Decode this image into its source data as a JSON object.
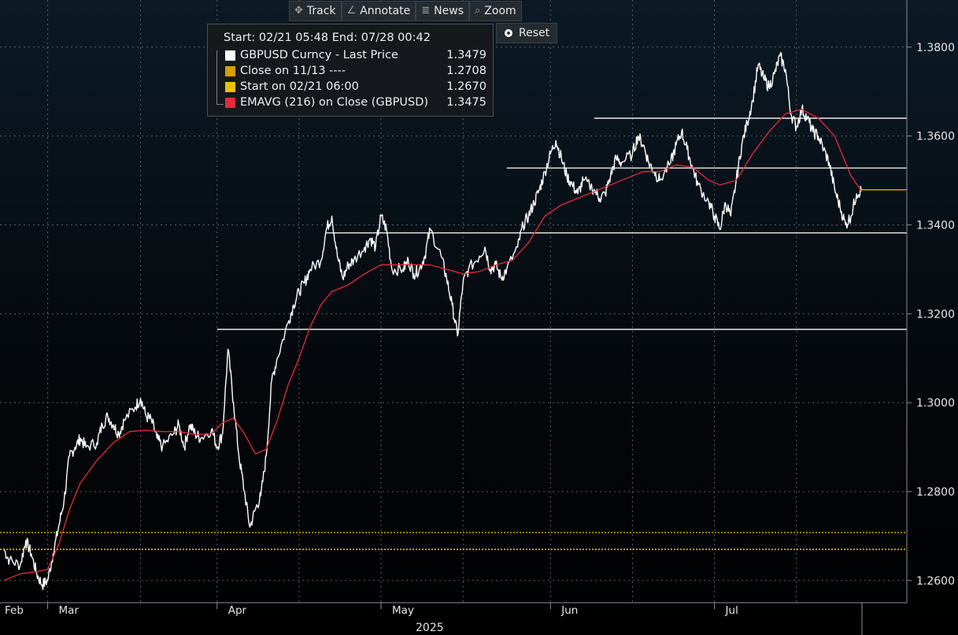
{
  "toolbar": {
    "track": "Track",
    "annotate": "Annotate",
    "news": "News",
    "zoom": "Zoom",
    "reset": "Reset"
  },
  "legend": {
    "header": "Start: 02/21 05:48 End: 07/28 00:42",
    "rows": [
      {
        "name": "GBPUSD Curncy - Last Price",
        "value": "1.3479",
        "color": "#ffffff"
      },
      {
        "name": "Close on 11/13 ----",
        "value": "1.2708",
        "color": "#d6a000"
      },
      {
        "name": "Start on 02/21 06:00",
        "value": "1.2670",
        "color": "#e8c000"
      },
      {
        "name": "EMAVG (216)  on Close (GBPUSD)",
        "value": "1.3475",
        "color": "#e8283c"
      }
    ]
  },
  "chart_data": {
    "type": "line",
    "ylim": [
      1.255,
      1.3906
    ],
    "y_ticks": [
      1.26,
      1.28,
      1.3,
      1.32,
      1.34,
      1.36,
      1.38
    ],
    "y_tick_labels": [
      "1.2600",
      "1.2800",
      "1.3000",
      "1.3200",
      "1.3400",
      "1.3600",
      "1.3800"
    ],
    "x_start": "2025-02-21",
    "x_end": "2025-07-28",
    "x_ticks": [
      {
        "label": "Feb",
        "date": "2025-02-21"
      },
      {
        "label": "Mar",
        "date": "2025-03-01"
      },
      {
        "label": "Apr",
        "date": "2025-04-01"
      },
      {
        "label": "May",
        "date": "2025-05-01"
      },
      {
        "label": "Jun",
        "date": "2025-06-01"
      },
      {
        "label": "Jul",
        "date": "2025-07-01"
      }
    ],
    "x_axis_year": "2025",
    "grid": true,
    "series": [
      {
        "name": "GBPUSD Curncy - Last Price",
        "color": "#ffffff",
        "points": [
          [
            "2025-02-21",
            1.267
          ],
          [
            "2025-02-22",
            1.2645
          ],
          [
            "2025-02-24",
            1.2635
          ],
          [
            "2025-02-25",
            1.269
          ],
          [
            "2025-02-26",
            1.266
          ],
          [
            "2025-02-27",
            1.2615
          ],
          [
            "2025-02-28",
            1.259
          ],
          [
            "2025-03-01",
            1.26
          ],
          [
            "2025-03-02",
            1.266
          ],
          [
            "2025-03-03",
            1.272
          ],
          [
            "2025-03-04",
            1.278
          ],
          [
            "2025-03-05",
            1.288
          ],
          [
            "2025-03-06",
            1.29
          ],
          [
            "2025-03-07",
            1.292
          ],
          [
            "2025-03-08",
            1.29
          ],
          [
            "2025-03-10",
            1.291
          ],
          [
            "2025-03-11",
            1.295
          ],
          [
            "2025-03-12",
            1.297
          ],
          [
            "2025-03-13",
            1.295
          ],
          [
            "2025-03-14",
            1.293
          ],
          [
            "2025-03-15",
            1.296
          ],
          [
            "2025-03-17",
            1.299
          ],
          [
            "2025-03-18",
            1.301
          ],
          [
            "2025-03-19",
            1.297
          ],
          [
            "2025-03-20",
            1.296
          ],
          [
            "2025-03-21",
            1.292
          ],
          [
            "2025-03-22",
            1.29
          ],
          [
            "2025-03-24",
            1.293
          ],
          [
            "2025-03-25",
            1.295
          ],
          [
            "2025-03-26",
            1.29
          ],
          [
            "2025-03-27",
            1.295
          ],
          [
            "2025-03-28",
            1.293
          ],
          [
            "2025-03-29",
            1.292
          ],
          [
            "2025-03-31",
            1.294
          ],
          [
            "2025-04-01",
            1.29
          ],
          [
            "2025-04-02",
            1.293
          ],
          [
            "2025-04-03",
            1.312
          ],
          [
            "2025-04-04",
            1.3
          ],
          [
            "2025-04-05",
            1.288
          ],
          [
            "2025-04-06",
            1.28
          ],
          [
            "2025-04-07",
            1.272
          ],
          [
            "2025-04-08",
            1.276
          ],
          [
            "2025-04-09",
            1.279
          ],
          [
            "2025-04-10",
            1.288
          ],
          [
            "2025-04-11",
            1.305
          ],
          [
            "2025-04-12",
            1.31
          ],
          [
            "2025-04-14",
            1.318
          ],
          [
            "2025-04-15",
            1.322
          ],
          [
            "2025-04-16",
            1.325
          ],
          [
            "2025-04-17",
            1.327
          ],
          [
            "2025-04-18",
            1.33
          ],
          [
            "2025-04-20",
            1.332
          ],
          [
            "2025-04-21",
            1.339
          ],
          [
            "2025-04-22",
            1.342
          ],
          [
            "2025-04-23",
            1.333
          ],
          [
            "2025-04-24",
            1.328
          ],
          [
            "2025-04-25",
            1.331
          ],
          [
            "2025-04-26",
            1.332
          ],
          [
            "2025-04-28",
            1.335
          ],
          [
            "2025-04-29",
            1.337
          ],
          [
            "2025-04-30",
            1.335
          ],
          [
            "2025-05-01",
            1.342
          ],
          [
            "2025-05-02",
            1.339
          ],
          [
            "2025-05-03",
            1.33
          ],
          [
            "2025-05-05",
            1.33
          ],
          [
            "2025-05-06",
            1.332
          ],
          [
            "2025-05-07",
            1.329
          ],
          [
            "2025-05-08",
            1.33
          ],
          [
            "2025-05-09",
            1.333
          ],
          [
            "2025-05-10",
            1.339
          ],
          [
            "2025-05-12",
            1.333
          ],
          [
            "2025-05-13",
            1.328
          ],
          [
            "2025-05-14",
            1.322
          ],
          [
            "2025-05-15",
            1.315
          ],
          [
            "2025-05-16",
            1.327
          ],
          [
            "2025-05-17",
            1.33
          ],
          [
            "2025-05-19",
            1.333
          ],
          [
            "2025-05-20",
            1.335
          ],
          [
            "2025-05-21",
            1.33
          ],
          [
            "2025-05-22",
            1.331
          ],
          [
            "2025-05-23",
            1.328
          ],
          [
            "2025-05-24",
            1.33
          ],
          [
            "2025-05-26",
            1.335
          ],
          [
            "2025-05-27",
            1.34
          ],
          [
            "2025-05-28",
            1.342
          ],
          [
            "2025-05-29",
            1.345
          ],
          [
            "2025-05-30",
            1.348
          ],
          [
            "2025-05-31",
            1.352
          ],
          [
            "2025-06-01",
            1.356
          ],
          [
            "2025-06-02",
            1.359
          ],
          [
            "2025-06-03",
            1.355
          ],
          [
            "2025-06-04",
            1.351
          ],
          [
            "2025-06-05",
            1.349
          ],
          [
            "2025-06-06",
            1.347
          ],
          [
            "2025-06-07",
            1.35
          ],
          [
            "2025-06-09",
            1.348
          ],
          [
            "2025-06-10",
            1.346
          ],
          [
            "2025-06-11",
            1.347
          ],
          [
            "2025-06-12",
            1.351
          ],
          [
            "2025-06-13",
            1.355
          ],
          [
            "2025-06-14",
            1.354
          ],
          [
            "2025-06-16",
            1.356
          ],
          [
            "2025-06-17",
            1.36
          ],
          [
            "2025-06-18",
            1.358
          ],
          [
            "2025-06-19",
            1.354
          ],
          [
            "2025-06-20",
            1.352
          ],
          [
            "2025-06-21",
            1.35
          ],
          [
            "2025-06-23",
            1.354
          ],
          [
            "2025-06-24",
            1.358
          ],
          [
            "2025-06-25",
            1.361
          ],
          [
            "2025-06-26",
            1.357
          ],
          [
            "2025-06-27",
            1.353
          ],
          [
            "2025-06-28",
            1.349
          ],
          [
            "2025-06-30",
            1.345
          ],
          [
            "2025-07-01",
            1.342
          ],
          [
            "2025-07-02",
            1.339
          ],
          [
            "2025-07-03",
            1.345
          ],
          [
            "2025-07-04",
            1.342
          ],
          [
            "2025-07-05",
            1.35
          ],
          [
            "2025-07-06",
            1.358
          ],
          [
            "2025-07-07",
            1.363
          ],
          [
            "2025-07-08",
            1.368
          ],
          [
            "2025-07-09",
            1.376
          ],
          [
            "2025-07-10",
            1.373
          ],
          [
            "2025-07-11",
            1.371
          ],
          [
            "2025-07-12",
            1.374
          ],
          [
            "2025-07-13",
            1.378
          ],
          [
            "2025-07-14",
            1.375
          ],
          [
            "2025-07-15",
            1.365
          ],
          [
            "2025-07-16",
            1.362
          ],
          [
            "2025-07-17",
            1.366
          ],
          [
            "2025-07-18",
            1.364
          ],
          [
            "2025-07-19",
            1.361
          ],
          [
            "2025-07-20",
            1.36
          ],
          [
            "2025-07-21",
            1.357
          ],
          [
            "2025-07-22",
            1.354
          ],
          [
            "2025-07-23",
            1.348
          ],
          [
            "2025-07-24",
            1.344
          ],
          [
            "2025-07-25",
            1.34
          ],
          [
            "2025-07-26",
            1.342
          ],
          [
            "2025-07-27",
            1.347
          ],
          [
            "2025-07-28",
            1.3479
          ]
        ]
      },
      {
        "name": "EMAVG (216)  on Close (GBPUSD)",
        "color": "#e8283c",
        "points": [
          [
            "2025-02-21",
            1.26
          ],
          [
            "2025-02-24",
            1.2615
          ],
          [
            "2025-02-27",
            1.262
          ],
          [
            "2025-03-01",
            1.2625
          ],
          [
            "2025-03-03",
            1.268
          ],
          [
            "2025-03-05",
            1.276
          ],
          [
            "2025-03-07",
            1.282
          ],
          [
            "2025-03-10",
            1.287
          ],
          [
            "2025-03-13",
            1.291
          ],
          [
            "2025-03-16",
            1.2935
          ],
          [
            "2025-03-19",
            1.2938
          ],
          [
            "2025-03-22",
            1.2935
          ],
          [
            "2025-03-25",
            1.2935
          ],
          [
            "2025-03-28",
            1.2928
          ],
          [
            "2025-03-31",
            1.293
          ],
          [
            "2025-04-02",
            1.2955
          ],
          [
            "2025-04-04",
            1.2965
          ],
          [
            "2025-04-06",
            1.293
          ],
          [
            "2025-04-08",
            1.2885
          ],
          [
            "2025-04-10",
            1.2895
          ],
          [
            "2025-04-12",
            1.296
          ],
          [
            "2025-04-14",
            1.304
          ],
          [
            "2025-04-16",
            1.31
          ],
          [
            "2025-04-18",
            1.317
          ],
          [
            "2025-04-20",
            1.322
          ],
          [
            "2025-04-22",
            1.325
          ],
          [
            "2025-04-25",
            1.3265
          ],
          [
            "2025-04-28",
            1.329
          ],
          [
            "2025-05-01",
            1.331
          ],
          [
            "2025-05-04",
            1.331
          ],
          [
            "2025-05-07",
            1.331
          ],
          [
            "2025-05-10",
            1.331
          ],
          [
            "2025-05-13",
            1.33
          ],
          [
            "2025-05-16",
            1.329
          ],
          [
            "2025-05-19",
            1.3295
          ],
          [
            "2025-05-22",
            1.331
          ],
          [
            "2025-05-25",
            1.332
          ],
          [
            "2025-05-28",
            1.336
          ],
          [
            "2025-05-31",
            1.342
          ],
          [
            "2025-06-03",
            1.3445
          ],
          [
            "2025-06-06",
            1.346
          ],
          [
            "2025-06-09",
            1.3475
          ],
          [
            "2025-06-12",
            1.349
          ],
          [
            "2025-06-15",
            1.3505
          ],
          [
            "2025-06-18",
            1.352
          ],
          [
            "2025-06-21",
            1.352
          ],
          [
            "2025-06-24",
            1.3535
          ],
          [
            "2025-06-27",
            1.353
          ],
          [
            "2025-06-30",
            1.35
          ],
          [
            "2025-07-02",
            1.349
          ],
          [
            "2025-07-05",
            1.35
          ],
          [
            "2025-07-08",
            1.356
          ],
          [
            "2025-07-11",
            1.361
          ],
          [
            "2025-07-14",
            1.365
          ],
          [
            "2025-07-17",
            1.366
          ],
          [
            "2025-07-20",
            1.364
          ],
          [
            "2025-07-23",
            1.36
          ],
          [
            "2025-07-26",
            1.351
          ],
          [
            "2025-07-28",
            1.3475
          ]
        ]
      }
    ],
    "horizontal_lines": [
      {
        "name": "Close on 11/13",
        "value": 1.2708,
        "color": "#d6a000",
        "style": "dotted"
      },
      {
        "name": "Start on 02/21 06:00",
        "value": 1.267,
        "color": "#e8c000",
        "style": "dotted"
      },
      {
        "name": "level-1.3165",
        "value": 1.3165,
        "color": "#ffffff",
        "style": "solid",
        "from": "2025-04-01"
      },
      {
        "name": "level-1.3382",
        "value": 1.3382,
        "color": "#ffffff",
        "style": "solid",
        "from": "2025-04-21"
      },
      {
        "name": "level-1.3528",
        "value": 1.3528,
        "color": "#ffffff",
        "style": "solid",
        "from": "2025-05-24"
      },
      {
        "name": "level-1.3640",
        "value": 1.364,
        "color": "#ffffff",
        "style": "solid",
        "from": "2025-06-09"
      }
    ],
    "last_price_marker": {
      "value": 1.3479,
      "color": "#d6a000"
    }
  }
}
